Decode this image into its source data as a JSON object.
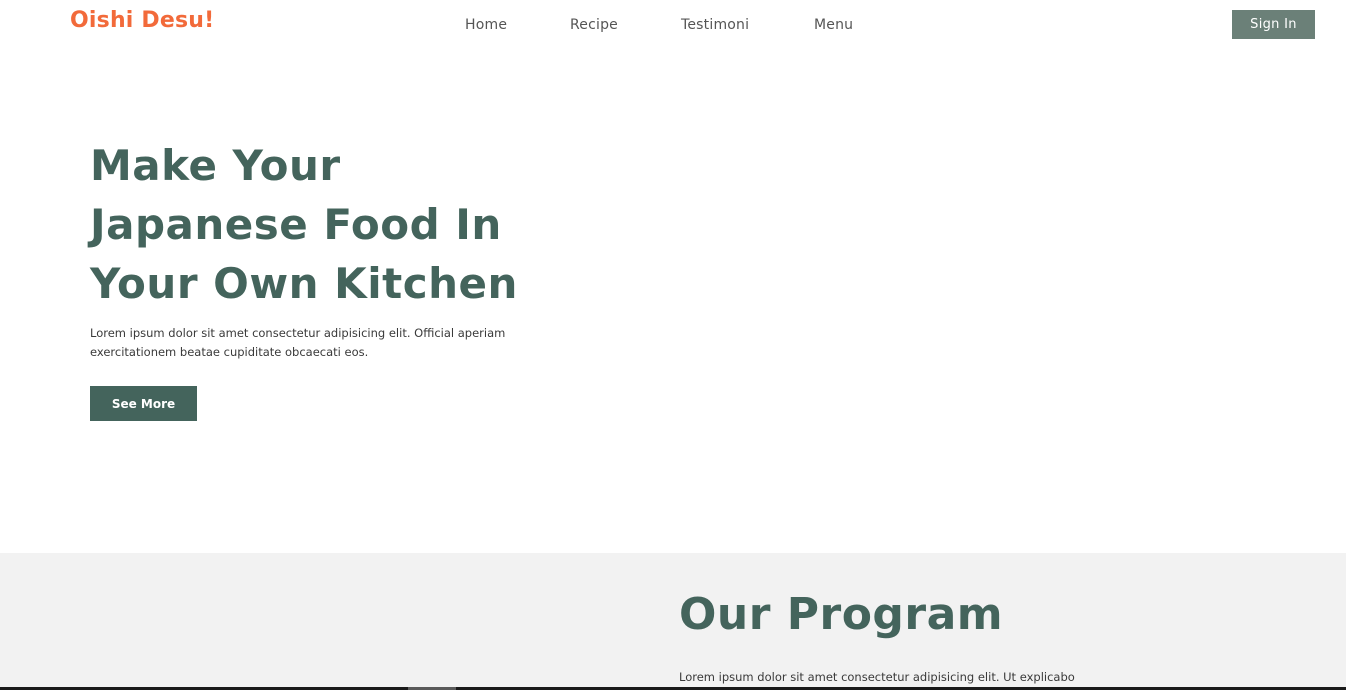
{
  "navbar": {
    "brand": "Oishi Desu!",
    "links": [
      "Home",
      "Recipe",
      "Testimoni",
      "Menu"
    ],
    "signin_label": "Sign In"
  },
  "hero": {
    "title": "Make Your Japanese Food In Your Own Kitchen",
    "description": "Lorem ipsum dolor sit amet consectetur adipisicing elit. Official aperiam exercitationem beatae cupiditate obcaecati eos.",
    "button_label": "See More"
  },
  "program": {
    "title": "Our Program",
    "description": "Lorem ipsum dolor sit amet consectetur adipisicing elit. Ut explicabo"
  },
  "colors": {
    "brand": "#f26a3a",
    "primary": "#44645c",
    "signin_bg": "#6b8078",
    "section_bg": "#f2f2f2"
  }
}
